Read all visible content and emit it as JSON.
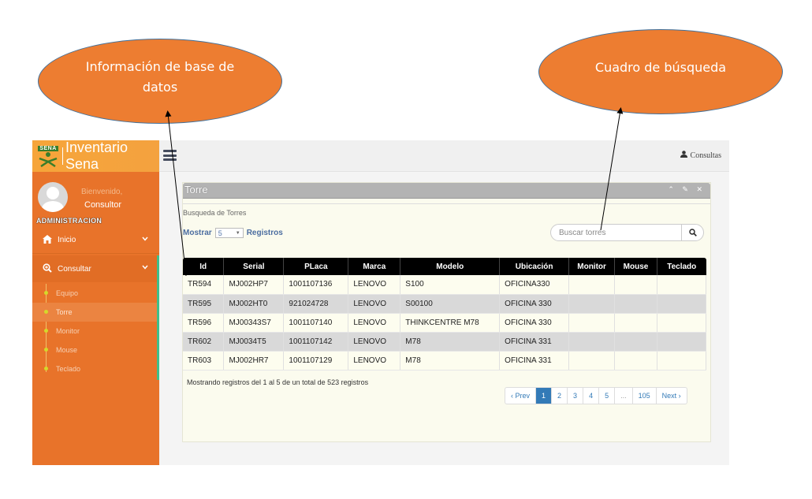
{
  "callouts": {
    "left": "Información de base de datos",
    "right": "Cuadro de búsqueda"
  },
  "brand": {
    "logo_text": "SENA",
    "title": "Inventario Sena"
  },
  "user": {
    "welcome": "Bienvenido,",
    "name": "Consultor",
    "role": "ADMINISTRACION"
  },
  "header": {
    "user_menu": "Consultas"
  },
  "sidebar": {
    "inicio": "Inicio",
    "consultar": "Consultar",
    "items": [
      {
        "label": "Equipo"
      },
      {
        "label": "Torre"
      },
      {
        "label": "Monitor"
      },
      {
        "label": "Mouse"
      },
      {
        "label": "Teclado"
      }
    ]
  },
  "panel": {
    "title": "Torre",
    "tools": "⌃ ✎ ✕",
    "subtitle": "Busqueda de Torres",
    "show_label": "Mostrar",
    "show_value": "5",
    "records_label": "Registros",
    "search_placeholder": "Buscar torres"
  },
  "table": {
    "headers": [
      "Id",
      "Serial",
      "PLaca",
      "Marca",
      "Modelo",
      "Ubicación",
      "Monitor",
      "Mouse",
      "Teclado"
    ],
    "rows": [
      [
        "TR594",
        "MJ002HP7",
        "1001107136",
        "LENOVO",
        "S100",
        "OFICINA330",
        "",
        "",
        ""
      ],
      [
        "TR595",
        "MJ002HT0",
        "921024728",
        "LENOVO",
        "S00100",
        "OFICINA 330",
        "",
        "",
        ""
      ],
      [
        "TR596",
        "MJ00343S7",
        "1001107140",
        "LENOVO",
        "THINKCENTRE M78",
        "OFICINA 330",
        "",
        "",
        ""
      ],
      [
        "TR602",
        "MJ0034T5",
        "1001107142",
        "LENOVO",
        "M78",
        "OFICINA 331",
        "",
        "",
        ""
      ],
      [
        "TR603",
        "MJ002HR7",
        "1001107129",
        "LENOVO",
        "M78",
        "OFICINA 331",
        "",
        "",
        ""
      ]
    ]
  },
  "info": "Mostrando registros del 1 al 5 de un total de 523 registros",
  "pagination": {
    "prev": "‹ Prev",
    "pages": [
      "1",
      "2",
      "3",
      "4",
      "5",
      "...",
      "105"
    ],
    "next": "Next ›",
    "active": "1"
  },
  "colors": {
    "sidebar": "#e8732a",
    "brand": "#f4a23f",
    "callout": "#ed7d31",
    "accent": "#337ab7"
  }
}
